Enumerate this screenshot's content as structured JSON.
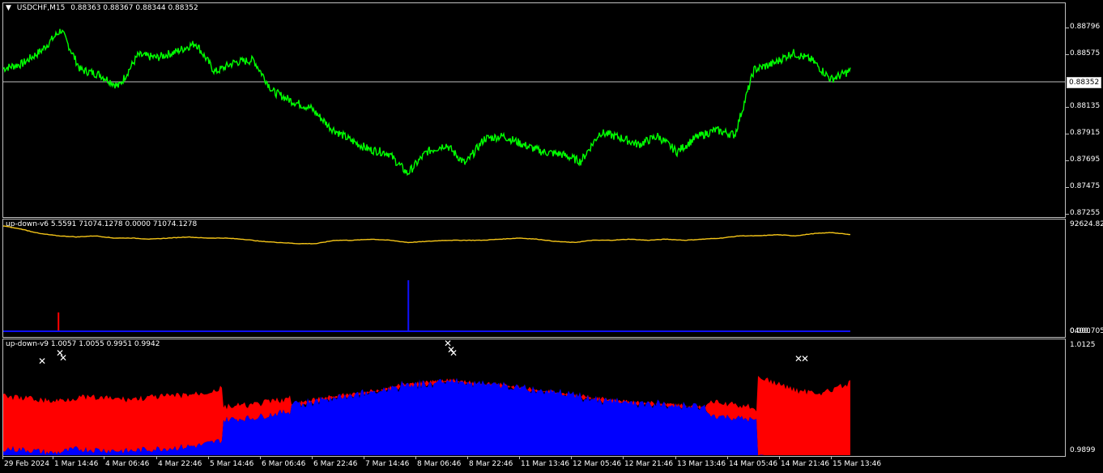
{
  "main_pane": {
    "symbol_label": "USDCHF,M15",
    "ohlc": "0.88363 0.88367 0.88344 0.88352",
    "current_price": "0.88352",
    "y_labels": [
      "0.88796",
      "0.88575",
      "0.88135",
      "0.87915",
      "0.87695",
      "0.87475",
      "0.87255"
    ]
  },
  "indicator1": {
    "label": "up-down-v6 5.5591 71074.1278 0.0000 71074.1278",
    "y_top": "92624.822",
    "y_bottom": "0.000",
    "y_bottom_overlap": "0400.705"
  },
  "indicator2": {
    "label": "up-down-v9 1.0057 1.0055 0.9951 0.9942",
    "y_top": "1.0125",
    "y_bottom": "0.9899"
  },
  "x_axis": {
    "labels": [
      "29 Feb 2024",
      "1 Mar 14:46",
      "4 Mar 06:46",
      "4 Mar 22:46",
      "5 Mar 14:46",
      "6 Mar 06:46",
      "6 Mar 22:46",
      "7 Mar 14:46",
      "8 Mar 06:46",
      "8 Mar 22:46",
      "11 Mar 13:46",
      "12 Mar 05:46",
      "12 Mar 21:46",
      "13 Mar 13:46",
      "14 Mar 05:46",
      "14 Mar 21:46",
      "15 Mar 13:46"
    ]
  },
  "colors": {
    "price_line": "#00ff00",
    "ma_line": "#f5c518",
    "spike_blue": "#1010ff",
    "spike_red": "#ff0000",
    "area_red": "#ff0000",
    "area_blue": "#0000ff",
    "marker": "#ffffff"
  },
  "chart_data": [
    {
      "type": "line",
      "series": [
        {
          "values": [
            0.8841,
            0.8845,
            0.8856,
            0.8873,
            0.884,
            0.8836,
            0.8826,
            0.8852,
            0.885,
            0.8855,
            0.8862,
            0.8838,
            0.8846,
            0.8848,
            0.8822,
            0.8814,
            0.8808,
            0.8792,
            0.8782,
            0.8774,
            0.8771,
            0.8754,
            0.8772,
            0.8778,
            0.8762,
            0.8783,
            0.8785,
            0.8778,
            0.8772,
            0.877,
            0.8764,
            0.8788,
            0.8784,
            0.8778,
            0.8785,
            0.8772,
            0.8784,
            0.879,
            0.8786,
            0.884,
            0.8845,
            0.8854,
            0.8848,
            0.8832,
            0.8839
          ]
        }
      ],
      "ylim": [
        0.8718,
        0.8895
      ]
    },
    {
      "type": "line",
      "series": [
        {
          "values": [
            0.95,
            0.92,
            0.88,
            0.86,
            0.85,
            0.86,
            0.84,
            0.84,
            0.83,
            0.84,
            0.85,
            0.84,
            0.84,
            0.83,
            0.81,
            0.8,
            0.79,
            0.79,
            0.82,
            0.82,
            0.83,
            0.82,
            0.8,
            0.81,
            0.82,
            0.82,
            0.82,
            0.83,
            0.84,
            0.83,
            0.81,
            0.8,
            0.82,
            0.82,
            0.83,
            0.82,
            0.83,
            0.82,
            0.83,
            0.84,
            0.86,
            0.86,
            0.87,
            0.86,
            0.88,
            0.89,
            0.87
          ]
        }
      ],
      "spikes": [
        {
          "x_index": 3,
          "value": 0.17,
          "color": "red"
        },
        {
          "x_index": 22,
          "value": 0.46,
          "color": "blue"
        }
      ]
    },
    {
      "type": "area",
      "series": [
        {
          "values": [
            0.9963,
            0.996,
            0.9954,
            0.9962,
            0.996,
            0.9958,
            0.9962,
            0.9965,
            0.997,
            0.9982,
            0.9985,
            0.9994,
            1.0001,
            1.0011,
            1.0017,
            1.0025,
            1.0035,
            1.004,
            1.0045,
            1.0038,
            1.0036,
            1.0028,
            1.0022,
            1.0015,
            1.0008,
            1.0002,
            1.0,
            0.9996,
            0.9993,
            0.9987,
            0.9982,
            0.9964,
            0.9948,
            0.9946,
            0.9964
          ]
        }
      ],
      "ylim": [
        0.9899,
        1.0125
      ]
    }
  ]
}
